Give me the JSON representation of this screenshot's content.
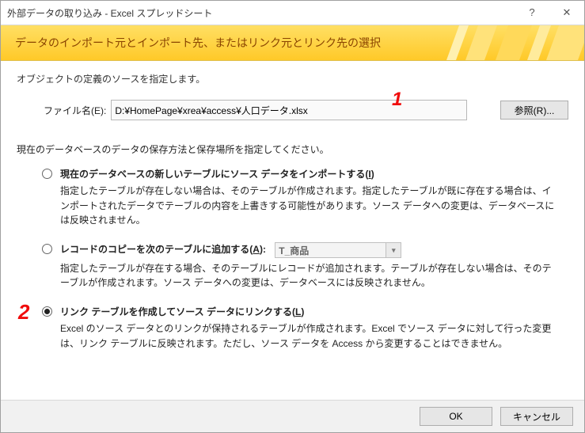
{
  "titlebar": {
    "title": "外部データの取り込み - Excel スプレッドシート"
  },
  "ribbon": {
    "heading": "データのインポート元とインポート先、またはリンク元とリンク先の選択"
  },
  "instructions": {
    "line1": "オブジェクトの定義のソースを指定します。"
  },
  "file": {
    "label": "ファイル名(E):",
    "value": "D:¥HomePage¥xrea¥access¥人口データ.xlsx",
    "browse": "参照(R)..."
  },
  "annot": {
    "m1": "1",
    "m2": "2"
  },
  "section2_label": "現在のデータベースのデータの保存方法と保存場所を指定してください。",
  "opt1": {
    "title_pre": "現在のデータベースの新しいテーブルにソース データをインポートする(",
    "title_u": "I",
    "title_post": ")",
    "desc": "指定したテーブルが存在しない場合は、そのテーブルが作成されます。指定したテーブルが既に存在する場合は、インポートされたデータでテーブルの内容を上書きする可能性があります。ソース データへの変更は、データベースには反映されません。"
  },
  "opt2": {
    "title_pre": "レコードのコピーを次のテーブルに追加する(",
    "title_u": "A",
    "title_post": "):",
    "combo_value": "T_商品",
    "desc": "指定したテーブルが存在する場合、そのテーブルにレコードが追加されます。テーブルが存在しない場合は、そのテーブルが作成されます。ソース データへの変更は、データベースには反映されません。"
  },
  "opt3": {
    "title_pre": "リンク テーブルを作成してソース データにリンクする(",
    "title_u": "L",
    "title_post": ")",
    "desc": "Excel のソース データとのリンクが保持されるテーブルが作成されます。Excel でソース データに対して行った変更は、リンク テーブルに反映されます。ただし、ソース データを Access から変更することはできません。"
  },
  "footer": {
    "ok": "OK",
    "cancel": "キャンセル"
  }
}
